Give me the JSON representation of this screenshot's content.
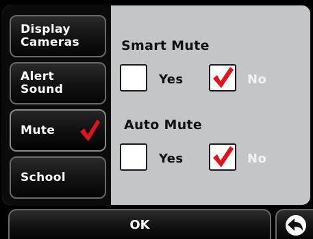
{
  "sidebar": {
    "items": [
      {
        "label": "Display\nCameras",
        "checked": false
      },
      {
        "label": "Alert\nSound",
        "checked": false
      },
      {
        "label": "Mute",
        "checked": true
      },
      {
        "label": "School",
        "checked": false
      }
    ]
  },
  "smart_mute": {
    "title": "Smart Mute",
    "yes_label": "Yes",
    "no_label": "No",
    "selected": "No"
  },
  "auto_mute": {
    "title": "Auto Mute",
    "yes_label": "Yes",
    "no_label": "No",
    "selected": "No"
  },
  "footer": {
    "ok_label": "OK",
    "back_icon": "back-arrow-icon"
  },
  "colors": {
    "checkmark": "#e0141e",
    "panel_bg": "#c4c5c9",
    "button_bg": "#111111"
  }
}
